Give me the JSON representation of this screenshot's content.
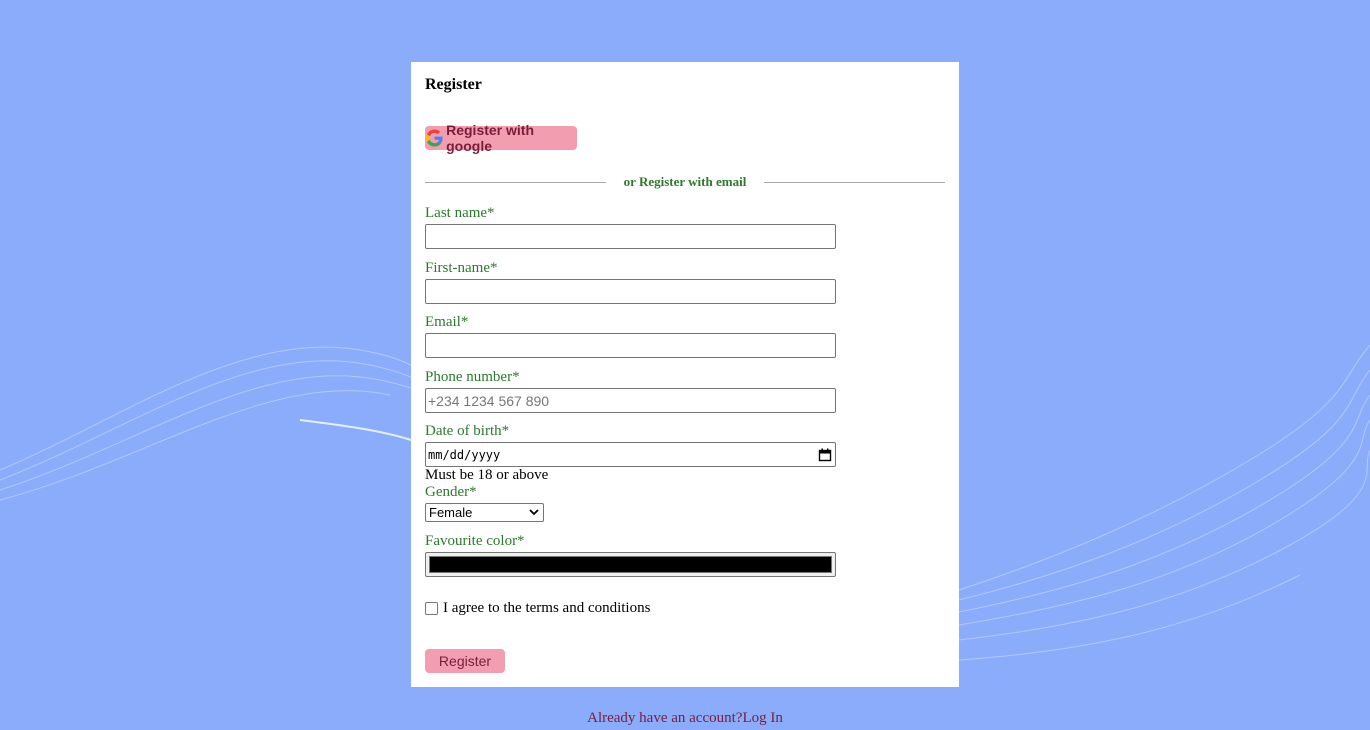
{
  "form": {
    "title": "Register",
    "google_button_label": "Register with google",
    "divider_text": "or Register with email",
    "fields": {
      "last_name": {
        "label": "Last name*",
        "value": ""
      },
      "first_name": {
        "label": "First-name*",
        "value": ""
      },
      "email": {
        "label": "Email*",
        "value": ""
      },
      "phone": {
        "label": "Phone number*",
        "placeholder": "+234 1234 567 890",
        "value": ""
      },
      "dob": {
        "label": "Date of birth*",
        "placeholder": "mm/dd/yyyy",
        "note": "Must be 18 or above"
      },
      "gender": {
        "label": "Gender*",
        "selected": "Female"
      },
      "color": {
        "label": "Favourite color*",
        "value": "#000000"
      }
    },
    "terms_label": "I agree to the terms and conditions",
    "terms_checked": false,
    "submit_label": "Register"
  },
  "footer": {
    "prompt": "Already have an account?",
    "login_link": "Log In"
  },
  "colors": {
    "background": "#8aacfb",
    "accent_button": "#f29eb0",
    "label_green": "#2c7a2c",
    "link_maroon": "#7a1d3a"
  },
  "icons": [
    "google-icon",
    "calendar-icon",
    "chevron-down-icon"
  ]
}
